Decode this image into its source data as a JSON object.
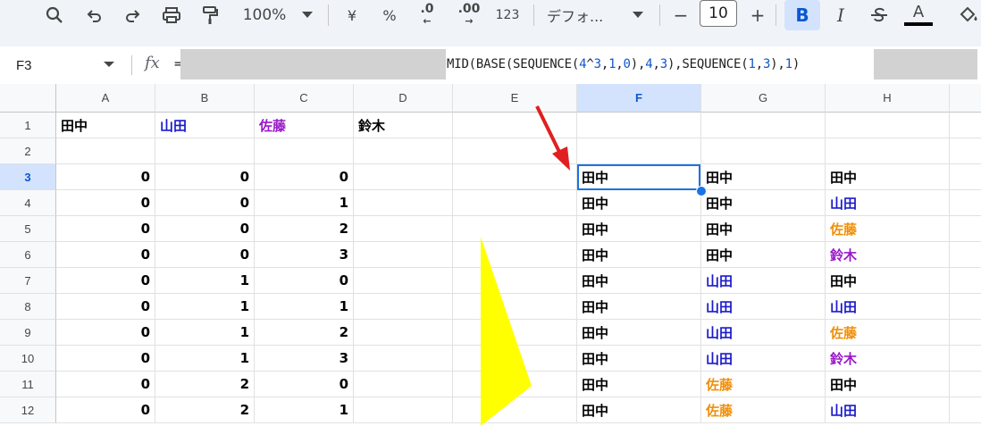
{
  "toolbar": {
    "zoom": "100%",
    "currency": "¥",
    "percent": "%",
    "dec_decrease": ".0",
    "dec_increase": ".00",
    "number_format": "123",
    "font": "デフォ...",
    "font_size": "10",
    "bold": "B",
    "italic": "I",
    "text_color": "A"
  },
  "formula_bar": {
    "cell_ref": "F3",
    "fx": "fx",
    "equals": "=",
    "formula_visible": "MID(BASE(SEQUENCE(4^3,1,0),4,3),SEQUENCE(1,3),1)"
  },
  "colors": {
    "black": "#000000",
    "blue": "#1a1acc",
    "purple": "#9a18c8",
    "orange": "#f0900c",
    "red_arrow": "#d93025",
    "yellow": "#ffff00"
  },
  "columns": [
    "A",
    "B",
    "C",
    "D",
    "E",
    "F",
    "G",
    "H"
  ],
  "selected_column": "F",
  "selected_row": "3",
  "rows": [
    {
      "num": "1",
      "cells": {
        "A": {
          "v": "田中",
          "c": "black"
        },
        "B": {
          "v": "山田",
          "c": "blue"
        },
        "C": {
          "v": "佐藤",
          "c": "purple"
        },
        "D": {
          "v": "鈴木",
          "c": "black"
        }
      }
    },
    {
      "num": "2",
      "cells": {}
    },
    {
      "num": "3",
      "cells": {
        "A": {
          "v": "0",
          "n": 1
        },
        "B": {
          "v": "0",
          "n": 1
        },
        "C": {
          "v": "0",
          "n": 1
        },
        "F": {
          "v": "田中",
          "c": "black"
        },
        "G": {
          "v": "田中",
          "c": "black"
        },
        "H": {
          "v": "田中",
          "c": "black"
        }
      }
    },
    {
      "num": "4",
      "cells": {
        "A": {
          "v": "0",
          "n": 1
        },
        "B": {
          "v": "0",
          "n": 1
        },
        "C": {
          "v": "1",
          "n": 1
        },
        "F": {
          "v": "田中",
          "c": "black"
        },
        "G": {
          "v": "田中",
          "c": "black"
        },
        "H": {
          "v": "山田",
          "c": "blue"
        }
      }
    },
    {
      "num": "5",
      "cells": {
        "A": {
          "v": "0",
          "n": 1
        },
        "B": {
          "v": "0",
          "n": 1
        },
        "C": {
          "v": "2",
          "n": 1
        },
        "F": {
          "v": "田中",
          "c": "black"
        },
        "G": {
          "v": "田中",
          "c": "black"
        },
        "H": {
          "v": "佐藤",
          "c": "orange"
        }
      }
    },
    {
      "num": "6",
      "cells": {
        "A": {
          "v": "0",
          "n": 1
        },
        "B": {
          "v": "0",
          "n": 1
        },
        "C": {
          "v": "3",
          "n": 1
        },
        "F": {
          "v": "田中",
          "c": "black"
        },
        "G": {
          "v": "田中",
          "c": "black"
        },
        "H": {
          "v": "鈴木",
          "c": "purple"
        }
      }
    },
    {
      "num": "7",
      "cells": {
        "A": {
          "v": "0",
          "n": 1
        },
        "B": {
          "v": "1",
          "n": 1
        },
        "C": {
          "v": "0",
          "n": 1
        },
        "F": {
          "v": "田中",
          "c": "black"
        },
        "G": {
          "v": "山田",
          "c": "blue"
        },
        "H": {
          "v": "田中",
          "c": "black"
        }
      }
    },
    {
      "num": "8",
      "cells": {
        "A": {
          "v": "0",
          "n": 1
        },
        "B": {
          "v": "1",
          "n": 1
        },
        "C": {
          "v": "1",
          "n": 1
        },
        "F": {
          "v": "田中",
          "c": "black"
        },
        "G": {
          "v": "山田",
          "c": "blue"
        },
        "H": {
          "v": "山田",
          "c": "blue"
        }
      }
    },
    {
      "num": "9",
      "cells": {
        "A": {
          "v": "0",
          "n": 1
        },
        "B": {
          "v": "1",
          "n": 1
        },
        "C": {
          "v": "2",
          "n": 1
        },
        "F": {
          "v": "田中",
          "c": "black"
        },
        "G": {
          "v": "山田",
          "c": "blue"
        },
        "H": {
          "v": "佐藤",
          "c": "orange"
        }
      }
    },
    {
      "num": "10",
      "cells": {
        "A": {
          "v": "0",
          "n": 1
        },
        "B": {
          "v": "1",
          "n": 1
        },
        "C": {
          "v": "3",
          "n": 1
        },
        "F": {
          "v": "田中",
          "c": "black"
        },
        "G": {
          "v": "山田",
          "c": "blue"
        },
        "H": {
          "v": "鈴木",
          "c": "purple"
        }
      }
    },
    {
      "num": "11",
      "cells": {
        "A": {
          "v": "0",
          "n": 1
        },
        "B": {
          "v": "2",
          "n": 1
        },
        "C": {
          "v": "0",
          "n": 1
        },
        "F": {
          "v": "田中",
          "c": "black"
        },
        "G": {
          "v": "佐藤",
          "c": "orange"
        },
        "H": {
          "v": "田中",
          "c": "black"
        }
      }
    },
    {
      "num": "12",
      "cells": {
        "A": {
          "v": "0",
          "n": 1
        },
        "B": {
          "v": "2",
          "n": 1
        },
        "C": {
          "v": "1",
          "n": 1
        },
        "F": {
          "v": "田中",
          "c": "black"
        },
        "G": {
          "v": "佐藤",
          "c": "orange"
        },
        "H": {
          "v": "山田",
          "c": "blue"
        }
      }
    }
  ]
}
